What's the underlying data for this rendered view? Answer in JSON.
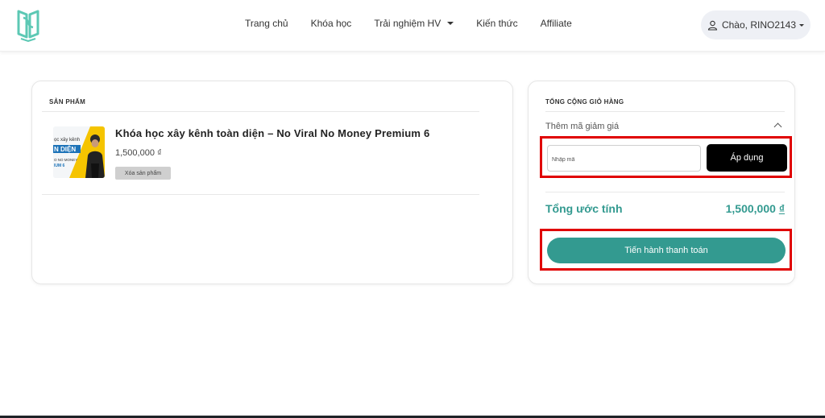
{
  "nav": {
    "items": [
      {
        "label": "Trang chủ"
      },
      {
        "label": "Khóa học"
      },
      {
        "label": "Trải nghiệm HV"
      },
      {
        "label": "Kiến thức"
      },
      {
        "label": "Affiliate"
      }
    ],
    "user_greeting": "Chào, RINO2143"
  },
  "cart": {
    "products_heading": "SẢN PHẨM",
    "product": {
      "title": "Khóa học xây kênh toàn diện – No Viral No Money Premium 6",
      "price": "1,500,000 ₫",
      "remove_label": "Xóa sản phẩm",
      "thumbnail_text": [
        "ọc xây kênh",
        "N DIỆN",
        "O NO MONEY",
        "IUM 6"
      ]
    }
  },
  "summary": {
    "heading": "TỔNG CỘNG GIỎ HÀNG",
    "coupon_label": "Thêm mã giảm giá",
    "coupon_placeholder": "Nhập mã",
    "apply_label": "Áp dụng",
    "total_label": "Tổng ước tính",
    "total_amount": "1,500,000",
    "currency": "₫",
    "checkout_label": "Tiến hành thanh toán"
  },
  "colors": {
    "accent": "#339a90",
    "highlight": "#e00000",
    "apply_button": "#000000"
  }
}
